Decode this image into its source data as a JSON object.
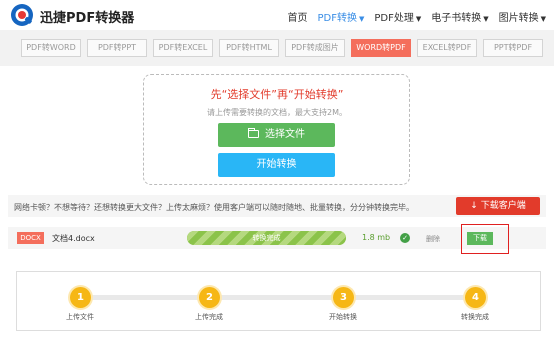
{
  "header": {
    "brand": "迅捷PDF转换器",
    "nav": [
      {
        "label": "首页",
        "active": false,
        "dropdown": false
      },
      {
        "label": "PDF转换",
        "active": true,
        "dropdown": true
      },
      {
        "label": "PDF处理",
        "active": false,
        "dropdown": true
      },
      {
        "label": "电子书转换",
        "active": false,
        "dropdown": true
      },
      {
        "label": "图片转换",
        "active": false,
        "dropdown": true
      }
    ]
  },
  "tabs": [
    {
      "label": "PDF转WORD",
      "active": false
    },
    {
      "label": "PDF转PPT",
      "active": false
    },
    {
      "label": "PDF转EXCEL",
      "active": false
    },
    {
      "label": "PDF转HTML",
      "active": false
    },
    {
      "label": "PDF转成图片",
      "active": false
    },
    {
      "label": "WORD转PDF",
      "active": true
    },
    {
      "label": "EXCEL转PDF",
      "active": false
    },
    {
      "label": "PPT转PDF",
      "active": false
    }
  ],
  "upload": {
    "title": "先“选择文件”再“开始转换”",
    "hint": "请上传需要转换的文档，最大支持2M。",
    "select_button": "选择文件",
    "start_button": "开始转换"
  },
  "promo": {
    "text": "网络卡顿？不想等待？还想转换更大文件？上传太麻烦？使用客户端可以随时随地、批量转换，分分钟转换完毕。",
    "download_client": "下载客户端"
  },
  "file": {
    "type_badge": "DOCX",
    "name": "文档4.docx",
    "progress_label": "转换完成",
    "progress": 1.0,
    "size": "1.8 mb",
    "delete": "删除",
    "download": "下载"
  },
  "steps": [
    {
      "number": "1",
      "label": "上传文件"
    },
    {
      "number": "2",
      "label": "上传完成"
    },
    {
      "number": "3",
      "label": "开始转换"
    },
    {
      "number": "4",
      "label": "转换完成"
    }
  ],
  "colors": {
    "accent_red": "#f46e5c",
    "green": "#5cb85c",
    "blue": "#29b6f6",
    "step_yellow": "#f6b715"
  }
}
